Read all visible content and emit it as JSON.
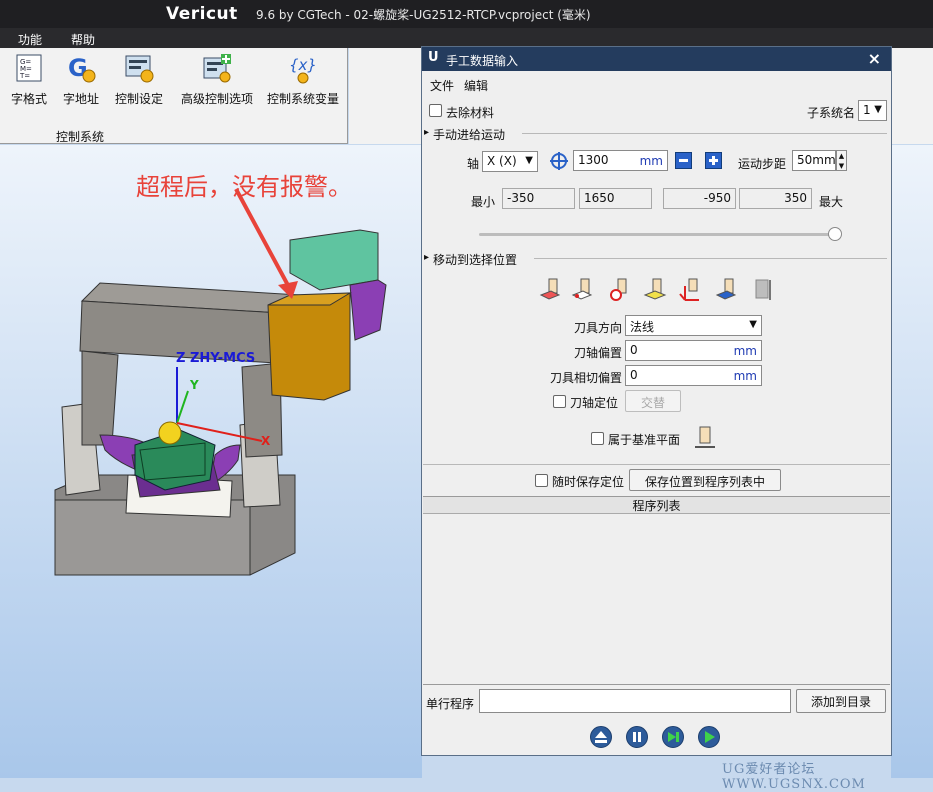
{
  "app": {
    "logo_text": "Vericut",
    "window_title": "9.6 by CGTech - 02-螺旋桨-UG2512-RTCP.vcproject (毫米)"
  },
  "menubar": {
    "items": [
      "功能",
      "帮助"
    ]
  },
  "ribbon": {
    "buttons": [
      {
        "label": "字格式",
        "icon": "word-format-icon"
      },
      {
        "label": "字地址",
        "icon": "word-address-icon"
      },
      {
        "label": "控制设定",
        "icon": "control-settings-icon"
      },
      {
        "label": "高级控制选项",
        "icon": "advanced-control-options-icon"
      },
      {
        "label": "控制系统变量",
        "icon": "control-variables-icon"
      }
    ],
    "group_label": "控制系统"
  },
  "viewport": {
    "annotation": "超程后，没有报警。",
    "csys_label": "Z ZHY-MCS",
    "axis_labels": {
      "x": "X",
      "y": "Y"
    }
  },
  "dialog": {
    "title": "手工数据输入",
    "close": "×",
    "menu": [
      "文件",
      "编辑"
    ],
    "remove_material_label": "去除材料",
    "subsystem_label": "子系统名",
    "subsystem_value": "1",
    "jog_section": "手动进给运动",
    "axis_label": "轴",
    "axis_value": "X (X)",
    "position_value": "1300",
    "unit_mm": "mm",
    "step_label": "运动步距",
    "step_value": "50mm",
    "min_label": "最小",
    "max_label": "最大",
    "limits": [
      "-350",
      "1650",
      "-950",
      "350"
    ],
    "slider_position": 0.99,
    "move_section": "移动到选择位置",
    "tool_direction_label": "刀具方向",
    "tool_direction_value": "法线",
    "axis_offset_label": "刀轴偏置",
    "axis_offset_value": "0",
    "tangent_offset_label": "刀具相切偏置",
    "tangent_offset_value": "0",
    "axis_locate_label": "刀轴定位",
    "alternate_button": "交替",
    "datum_plane_label": "属于基准平面",
    "save_anytime_label": "随时保存定位",
    "save_to_list_button": "保存位置到程序列表中",
    "program_list_header": "程序列表",
    "single_line_label": "单行程序",
    "add_to_list_button": "添加到目录",
    "colors": {
      "title_bg": "#243c5e",
      "unit_blue": "#1f3bb3"
    }
  },
  "watermark": "UG爱好者论坛 WWW.UGSNX.COM"
}
